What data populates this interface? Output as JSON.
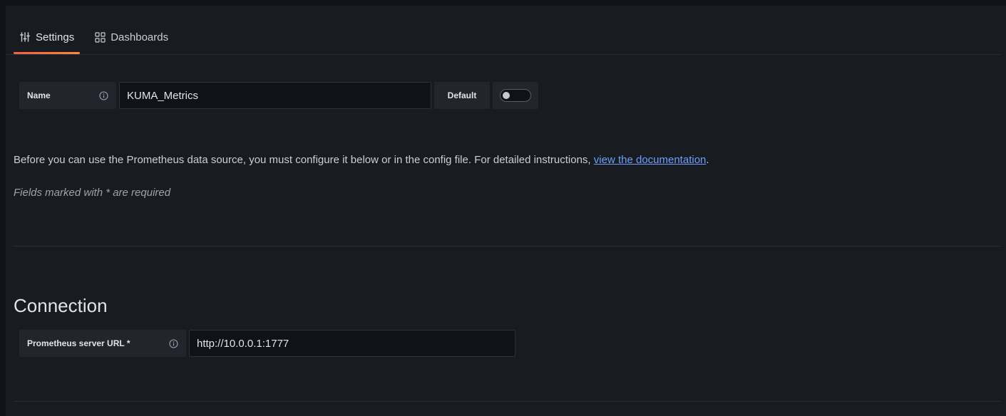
{
  "tabs": [
    {
      "label": "Settings",
      "icon": "sliders-icon",
      "active": true
    },
    {
      "label": "Dashboards",
      "icon": "apps-grid-icon",
      "active": false
    }
  ],
  "name_field": {
    "label": "Name",
    "value": "KUMA_Metrics",
    "default_label": "Default",
    "default_enabled": false
  },
  "description": {
    "text": "Before you can use the Prometheus data source, you must configure it below or in the config file. For detailed instructions, ",
    "link_text": "view the documentation",
    "suffix": "."
  },
  "required_note": "Fields marked with * are required",
  "connection": {
    "title": "Connection",
    "url_label": "Prometheus server URL *",
    "url_value": "http://10.0.0.1:1777"
  },
  "colors": {
    "background": "#181b1f",
    "tab_underline": "#f55f3e",
    "link": "#6e9fff"
  }
}
